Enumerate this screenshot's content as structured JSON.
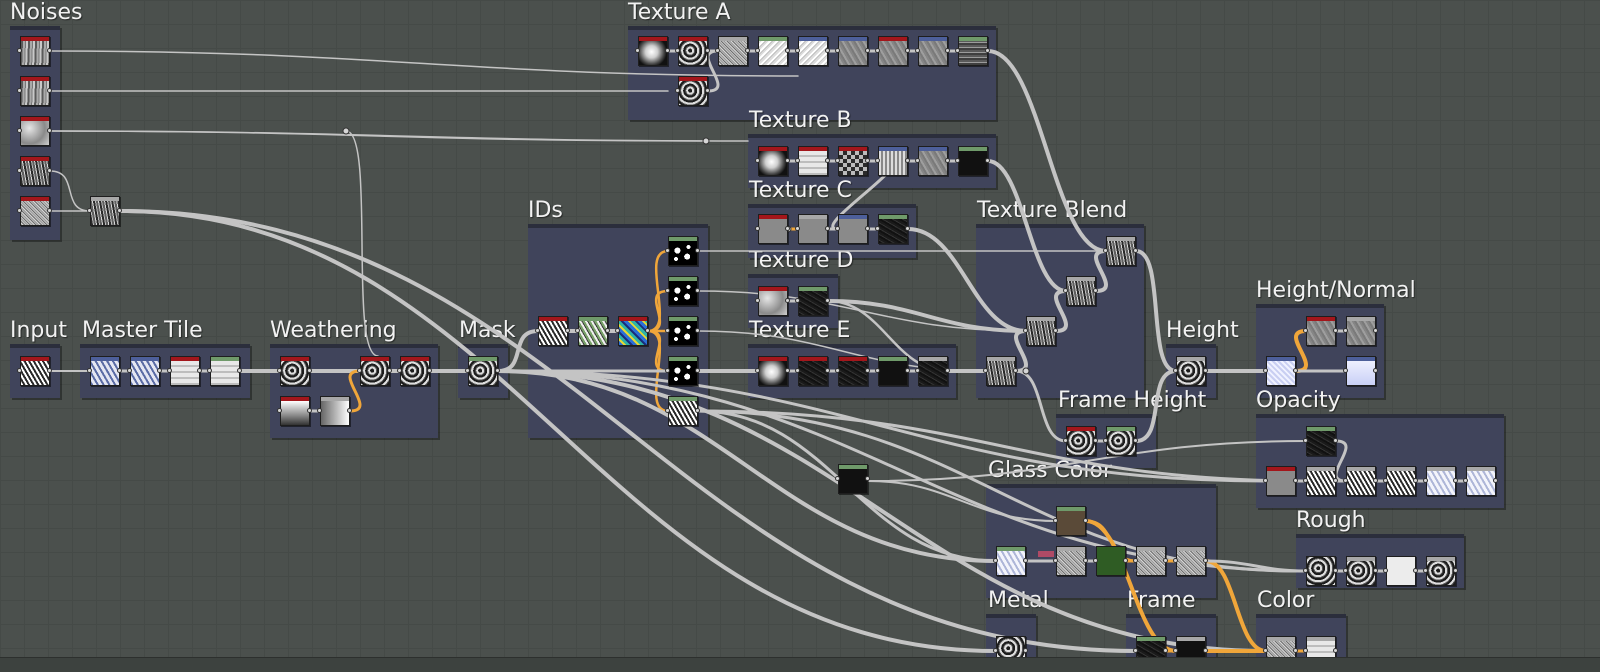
{
  "frames": [
    {
      "id": "noises",
      "title": "Noises"
    },
    {
      "id": "texture_a",
      "title": "Texture A"
    },
    {
      "id": "texture_b",
      "title": "Texture B"
    },
    {
      "id": "texture_c",
      "title": "Texture C"
    },
    {
      "id": "ids",
      "title": "IDs"
    },
    {
      "id": "texture_d",
      "title": "Texture D"
    },
    {
      "id": "texture_blend",
      "title": "Texture Blend"
    },
    {
      "id": "height_normal",
      "title": "Height/Normal"
    },
    {
      "id": "input",
      "title": "Input"
    },
    {
      "id": "master_tile",
      "title": "Master Tile"
    },
    {
      "id": "weathering",
      "title": "Weathering"
    },
    {
      "id": "mask",
      "title": "Mask"
    },
    {
      "id": "texture_e",
      "title": "Texture E"
    },
    {
      "id": "height",
      "title": "Height"
    },
    {
      "id": "frame_height",
      "title": "Frame Height"
    },
    {
      "id": "opacity",
      "title": "Opacity"
    },
    {
      "id": "glass_color",
      "title": "Glass Color"
    },
    {
      "id": "rough",
      "title": "Rough"
    },
    {
      "id": "metal",
      "title": "Metal"
    },
    {
      "id": "frame",
      "title": "Frame"
    },
    {
      "id": "color",
      "title": "Color"
    }
  ],
  "colors": {
    "header_red": "#a3161b",
    "header_green": "#6f9a6a",
    "header_blue": "#4d5f9a",
    "header_gray": "#a8a8a8",
    "link_gray": "#c4c4c4",
    "link_orange": "#f0a63a",
    "frame_bg": "#40445c"
  }
}
